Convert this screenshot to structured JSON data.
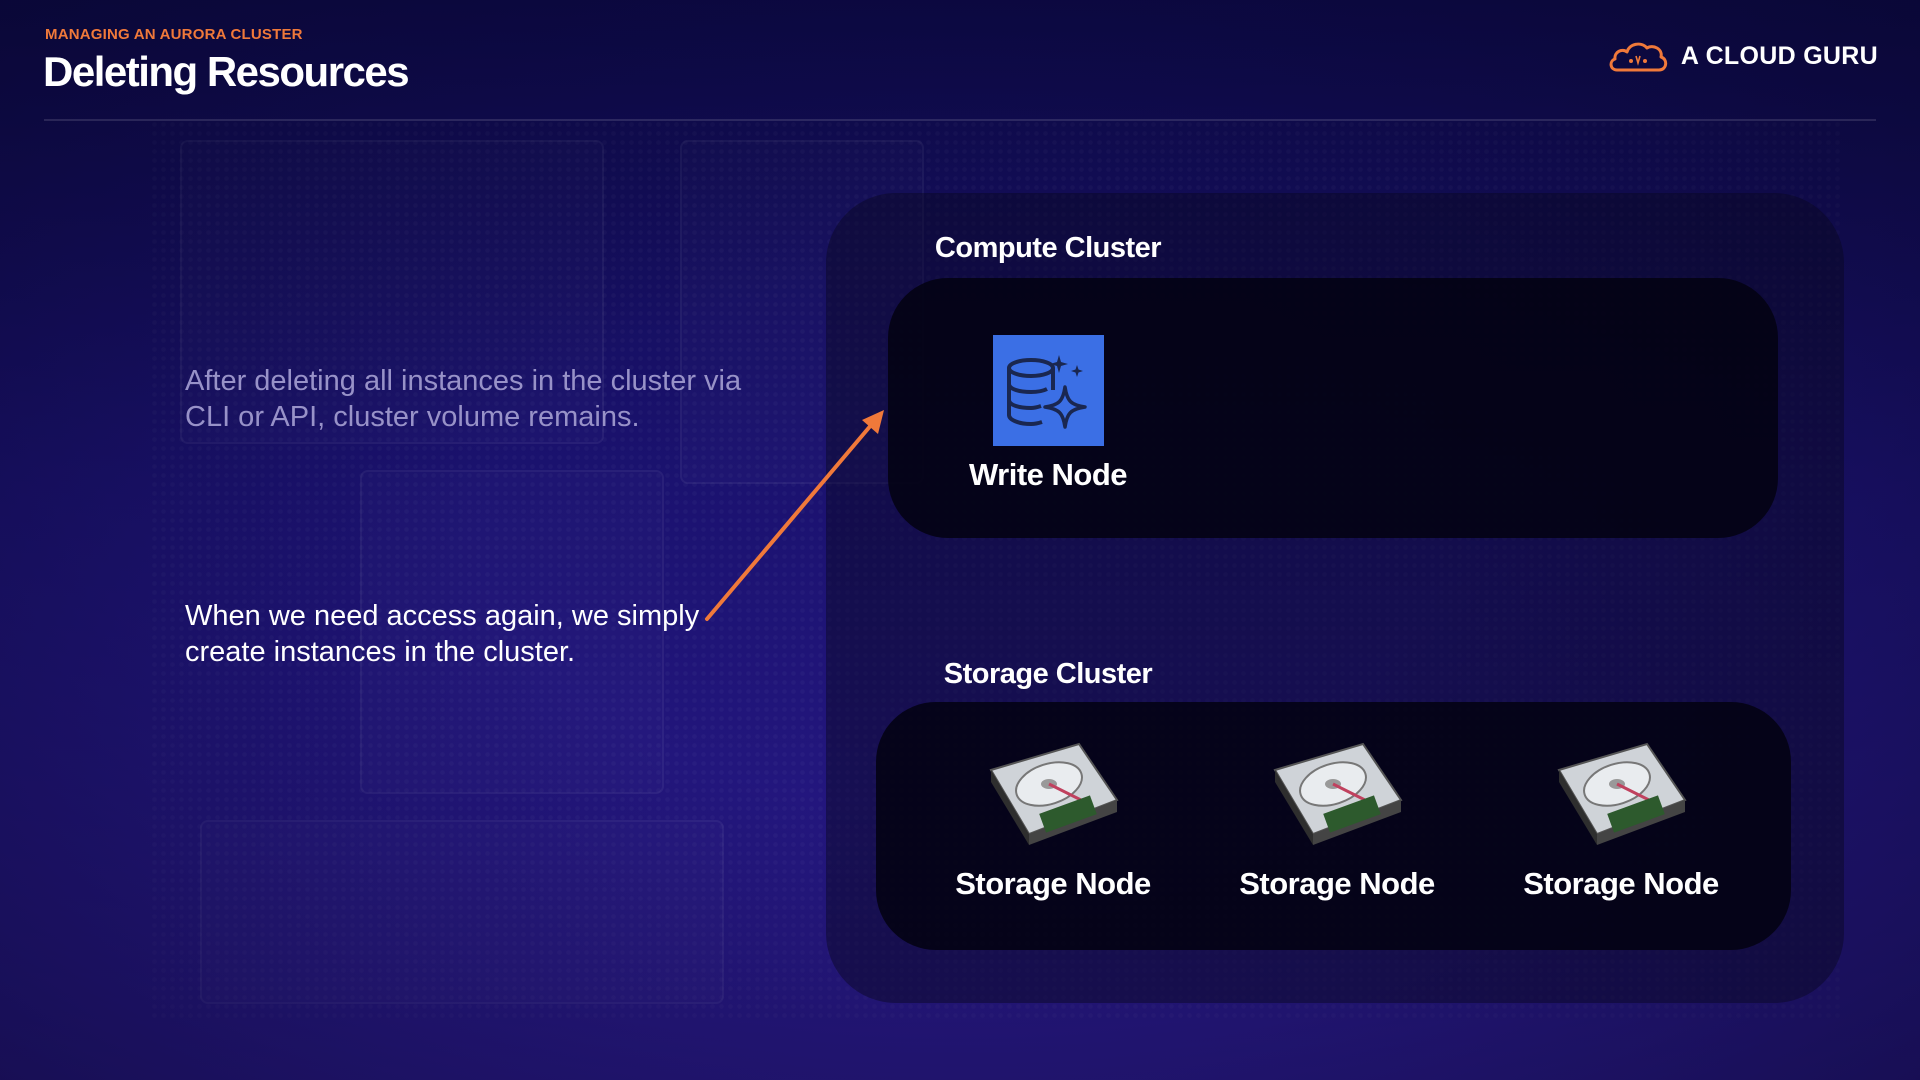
{
  "header": {
    "eyebrow": "MANAGING AN AURORA CLUSTER",
    "title": "Deleting Resources",
    "logo_text": "A CLOUD GURU"
  },
  "content": {
    "paragraph_1": "After deleting all instances in the cluster via CLI or API, cluster volume remains.",
    "paragraph_2": "When we need access again, we simply create instances in the cluster."
  },
  "diagram": {
    "compute_cluster": {
      "label": "Compute Cluster",
      "nodes": [
        {
          "label": "Write Node",
          "icon": "database-sparkle-icon"
        }
      ]
    },
    "storage_cluster": {
      "label": "Storage Cluster",
      "nodes": [
        {
          "label": "Storage Node",
          "icon": "hard-disk-icon"
        },
        {
          "label": "Storage Node",
          "icon": "hard-disk-icon"
        },
        {
          "label": "Storage Node",
          "icon": "hard-disk-icon"
        }
      ]
    }
  },
  "colors": {
    "accent": "#f0793a",
    "background": "#1b1270",
    "db_icon": "#3b6fe5"
  }
}
